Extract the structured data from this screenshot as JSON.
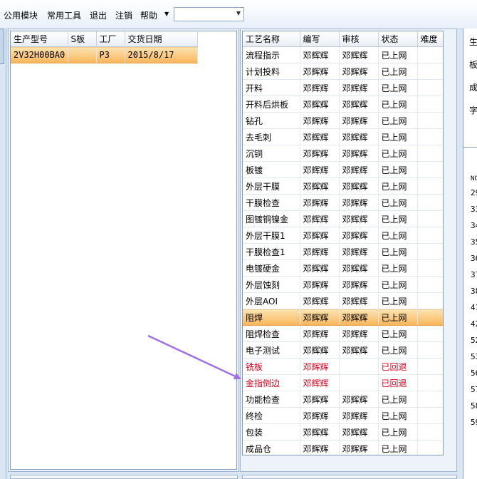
{
  "menubar": {
    "items": [
      "公用模块",
      "常用工具",
      "退出",
      "注销",
      "帮助"
    ],
    "combo_value": ""
  },
  "orders": {
    "headers": [
      "生产型号",
      "S板",
      "工厂",
      "交货日期"
    ],
    "rows": [
      {
        "model": "2V32H00BA0",
        "s": "",
        "factory": "P3",
        "date": "2015/8/17"
      }
    ]
  },
  "process": {
    "headers": [
      "工艺名称",
      "编写",
      "审核",
      "状态",
      "难度"
    ],
    "rows": [
      {
        "name": "流程指示",
        "writer": "邓辉辉",
        "reviewer": "邓辉辉",
        "status": "已上网",
        "difficulty": ""
      },
      {
        "name": "计划投料",
        "writer": "邓辉辉",
        "reviewer": "邓辉辉",
        "status": "已上网",
        "difficulty": ""
      },
      {
        "name": "开料",
        "writer": "邓辉辉",
        "reviewer": "邓辉辉",
        "status": "已上网",
        "difficulty": ""
      },
      {
        "name": "开料后烘板",
        "writer": "邓辉辉",
        "reviewer": "邓辉辉",
        "status": "已上网",
        "difficulty": ""
      },
      {
        "name": "钻孔",
        "writer": "邓辉辉",
        "reviewer": "邓辉辉",
        "status": "已上网",
        "difficulty": ""
      },
      {
        "name": "去毛刺",
        "writer": "邓辉辉",
        "reviewer": "邓辉辉",
        "status": "已上网",
        "difficulty": ""
      },
      {
        "name": "沉铜",
        "writer": "邓辉辉",
        "reviewer": "邓辉辉",
        "status": "已上网",
        "difficulty": ""
      },
      {
        "name": "板镀",
        "writer": "邓辉辉",
        "reviewer": "邓辉辉",
        "status": "已上网",
        "difficulty": ""
      },
      {
        "name": "外层干膜",
        "writer": "邓辉辉",
        "reviewer": "邓辉辉",
        "status": "已上网",
        "difficulty": ""
      },
      {
        "name": "干膜检查",
        "writer": "邓辉辉",
        "reviewer": "邓辉辉",
        "status": "已上网",
        "difficulty": ""
      },
      {
        "name": "图镀铜镍金",
        "writer": "邓辉辉",
        "reviewer": "邓辉辉",
        "status": "已上网",
        "difficulty": ""
      },
      {
        "name": "外层干膜1",
        "writer": "邓辉辉",
        "reviewer": "邓辉辉",
        "status": "已上网",
        "difficulty": ""
      },
      {
        "name": "干膜检查1",
        "writer": "邓辉辉",
        "reviewer": "邓辉辉",
        "status": "已上网",
        "difficulty": ""
      },
      {
        "name": "电镀硬金",
        "writer": "邓辉辉",
        "reviewer": "邓辉辉",
        "status": "已上网",
        "difficulty": ""
      },
      {
        "name": "外层蚀刻",
        "writer": "邓辉辉",
        "reviewer": "邓辉辉",
        "status": "已上网",
        "difficulty": ""
      },
      {
        "name": "外层AOI",
        "writer": "邓辉辉",
        "reviewer": "邓辉辉",
        "status": "已上网",
        "difficulty": ""
      },
      {
        "name": "阻焊",
        "writer": "邓辉辉",
        "reviewer": "邓辉辉",
        "status": "已上网",
        "difficulty": ""
      },
      {
        "name": "阻焊检查",
        "writer": "邓辉辉",
        "reviewer": "邓辉辉",
        "status": "已上网",
        "difficulty": ""
      },
      {
        "name": "电子测试",
        "writer": "邓辉辉",
        "reviewer": "邓辉辉",
        "status": "已上网",
        "difficulty": ""
      },
      {
        "name": "铣板",
        "writer": "邓辉辉",
        "reviewer": "",
        "status": "已回退",
        "difficulty": ""
      },
      {
        "name": "金指倒边",
        "writer": "邓辉辉",
        "reviewer": "",
        "status": "已回退",
        "difficulty": ""
      },
      {
        "name": "功能检查",
        "writer": "邓辉辉",
        "reviewer": "邓辉辉",
        "status": "已上网",
        "difficulty": ""
      },
      {
        "name": "终检",
        "writer": "邓辉辉",
        "reviewer": "邓辉辉",
        "status": "已上网",
        "difficulty": ""
      },
      {
        "name": "包装",
        "writer": "邓辉辉",
        "reviewer": "邓辉辉",
        "status": "已上网",
        "difficulty": ""
      },
      {
        "name": "成品仓",
        "writer": "邓辉辉",
        "reviewer": "邓辉辉",
        "status": "已上网",
        "difficulty": ""
      }
    ],
    "selected_index": 16
  },
  "right_panel": {
    "labels": [
      "生",
      "板",
      "成",
      "字"
    ],
    "list_header": "NO",
    "list_values": [
      "29",
      "33",
      "34",
      "35",
      "36",
      "37",
      "38",
      "41",
      "42",
      "52",
      "53",
      "56",
      "57",
      "58",
      "59"
    ]
  },
  "colors": {
    "selected_row": "#f8b559",
    "returned_text": "#e0001b",
    "annotation_arrow": "#a070e8"
  }
}
